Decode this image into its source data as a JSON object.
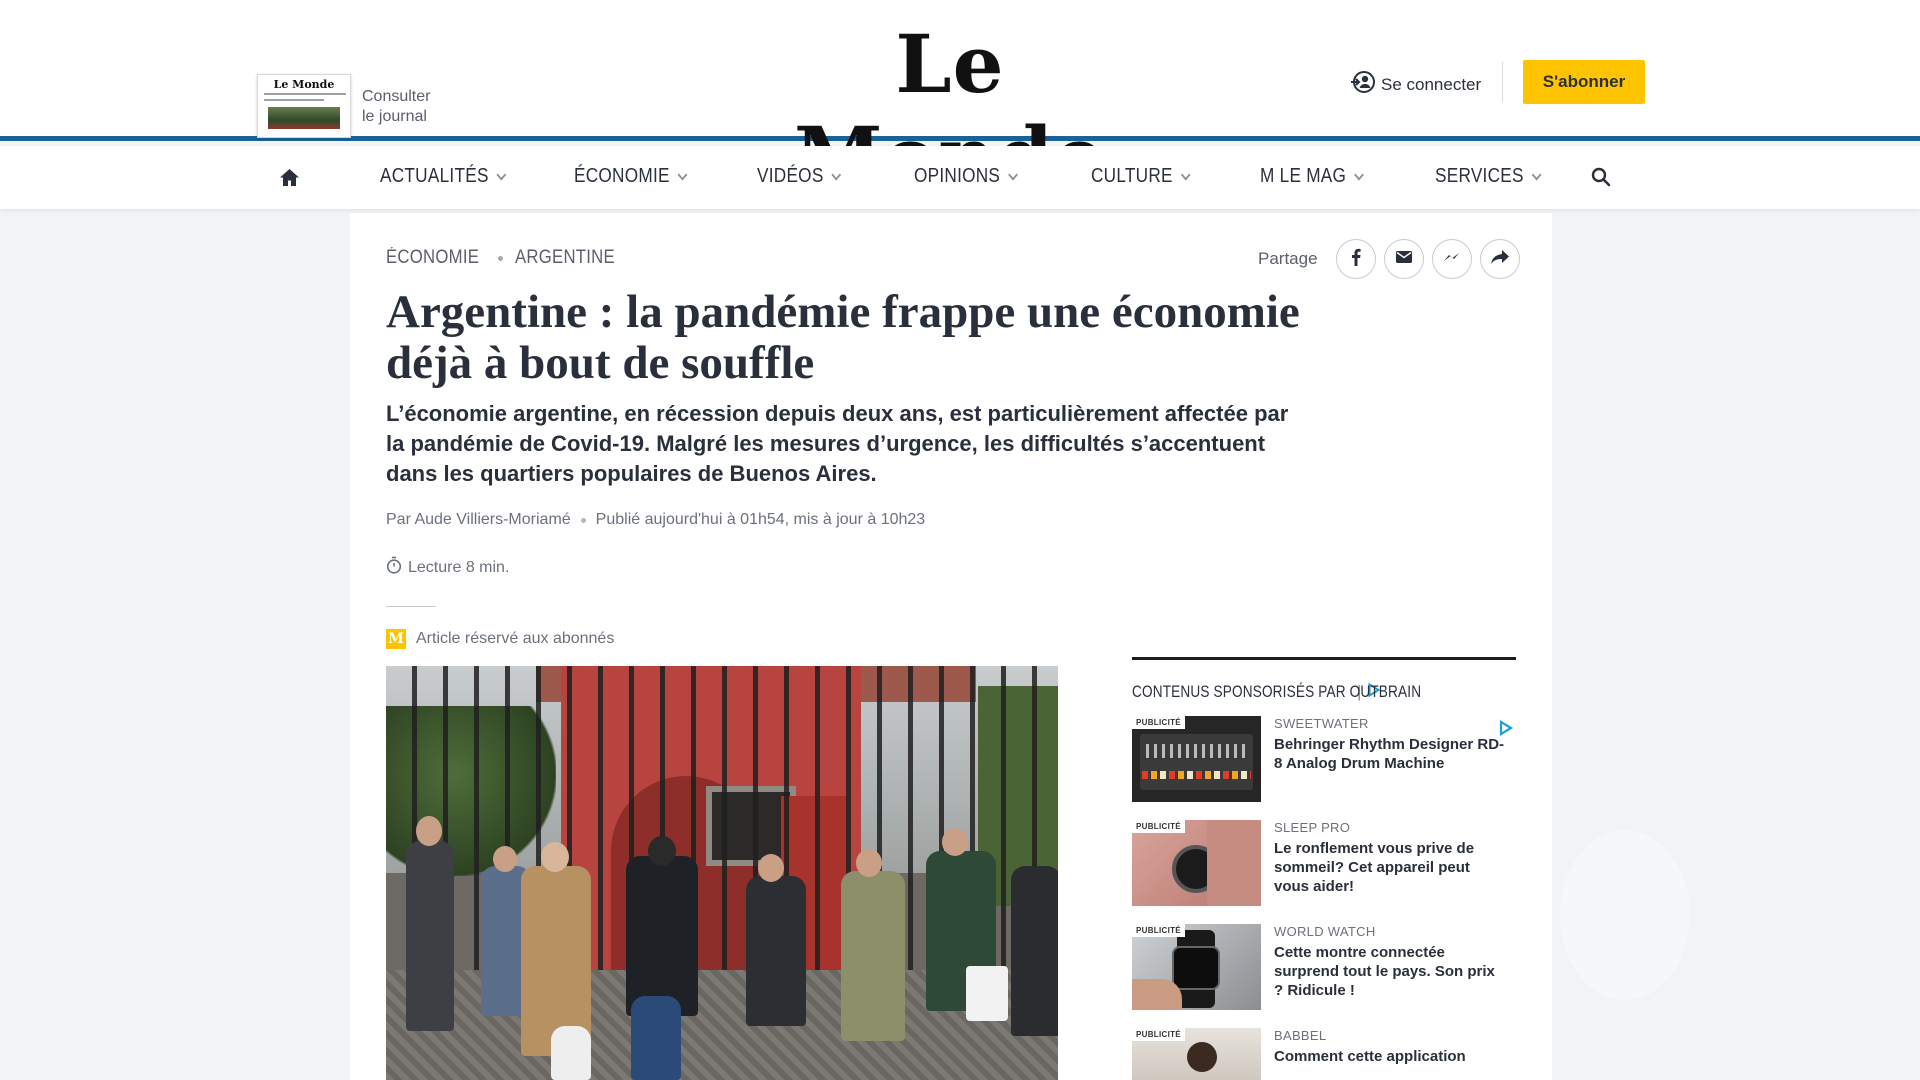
{
  "header": {
    "logo": "Le Monde",
    "journal_mast": "Le Monde",
    "journal_line1": "Consulter",
    "journal_line2": "le journal",
    "login_label": "Se connecter",
    "subscribe_label": "S'abonner"
  },
  "nav": {
    "items": [
      "ACTUALITÉS",
      "ÉCONOMIE",
      "VIDÉOS",
      "OPINIONS",
      "CULTURE",
      "M LE MAG",
      "SERVICES"
    ]
  },
  "article": {
    "breadcrumb": [
      "ÉCONOMIE",
      "ARGENTINE"
    ],
    "share_label": "Partage",
    "title": "Argentine : la pandémie frappe une économie déjà à bout de souffle",
    "description": "L’économie argentine, en récession depuis deux ans, est particulièrement affectée par la pandémie de Covid-19. Malgré les mesures d’urgence, les difficultés s’accentuent dans les quartiers populaires de Buenos Aires.",
    "author": "Par Aude Villiers-Moriamé",
    "published": "Publié aujourd'hui à 01h54, mis à jour à 10h23",
    "reading_time": "Lecture 8 min.",
    "premium_badge": "M",
    "premium_label": "Article réservé aux abonnés"
  },
  "sidebar": {
    "heading": "CONTENUS SPONSORISÉS PAR",
    "brand": "OUTBRAIN",
    "separator": "|",
    "ad_tag": "PUBLICITÉ",
    "ads": [
      {
        "source": "SWEETWATER",
        "headline": "Behringer Rhythm Designer RD-8 Analog Drum Machine"
      },
      {
        "source": "SLEEP PRO",
        "headline": "Le ronflement vous prive de sommeil? Cet appareil peut vous aider!"
      },
      {
        "source": "WORLD WATCH",
        "headline": "Cette montre connectée surprend tout le pays. Son prix ? Ridicule !"
      },
      {
        "source": "BABBEL",
        "headline": "Comment cette application"
      }
    ]
  },
  "colors": {
    "accent_blue": "#1a6397",
    "subscribe_yellow": "#ffc400",
    "text_dark": "#2a303b"
  },
  "icons": [
    "home-icon",
    "search-icon",
    "user-login-icon",
    "facebook-icon",
    "email-icon",
    "messenger-icon",
    "share-arrow-icon",
    "clock-icon",
    "adchoices-icon"
  ]
}
